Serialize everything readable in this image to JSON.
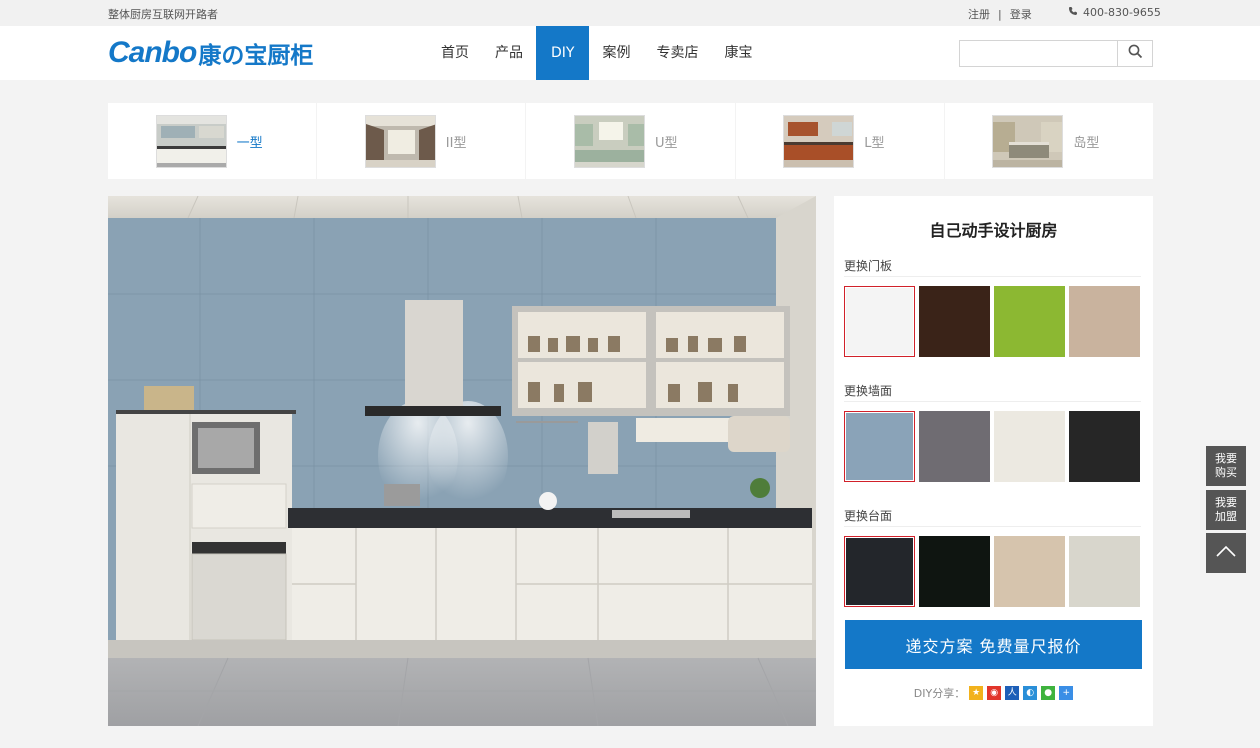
{
  "topbar": {
    "slogan": "整体厨房互联网开路者",
    "register": "注册",
    "login": "登录",
    "phone": "400-830-9655"
  },
  "brand": {
    "en": "Canbo",
    "cn": "康の宝厨柜"
  },
  "nav": {
    "items": [
      "首页",
      "产品",
      "DIY",
      "案例",
      "专卖店",
      "康宝"
    ],
    "active": "DIY"
  },
  "search": {
    "placeholder": ""
  },
  "layouts": [
    {
      "label": "一型",
      "active": true
    },
    {
      "label": "II型",
      "active": false
    },
    {
      "label": "U型",
      "active": false
    },
    {
      "label": "L型",
      "active": false
    },
    {
      "label": "岛型",
      "active": false
    }
  ],
  "panel": {
    "title": "自己动手设计厨房",
    "door_label": "更换门板",
    "wall_label": "更换墙面",
    "counter_label": "更换台面",
    "submit": "递交方案  免费量尺报价",
    "share_label": "DIY分享："
  },
  "colors": {
    "accent": "#1478c8",
    "selected_border": "#d1212a",
    "door": [
      "#f4f4f4",
      "#3a2318",
      "#8cb832",
      "#c9b39e"
    ],
    "wall": [
      "#8aa3b8",
      "#6f6c72",
      "#ece9e1",
      "#262626"
    ],
    "counter": [
      "#23262b",
      "#0f1511",
      "#d6c4ad",
      "#d8d6cc"
    ]
  },
  "selected": {
    "door": 0,
    "wall": 0,
    "counter": 0
  },
  "share_icons": [
    "qzone-icon",
    "weibo-icon",
    "renren-icon",
    "tencent-icon",
    "wechat-icon",
    "more-icon"
  ],
  "side": {
    "buy": "我要购买",
    "join": "我要加盟"
  }
}
